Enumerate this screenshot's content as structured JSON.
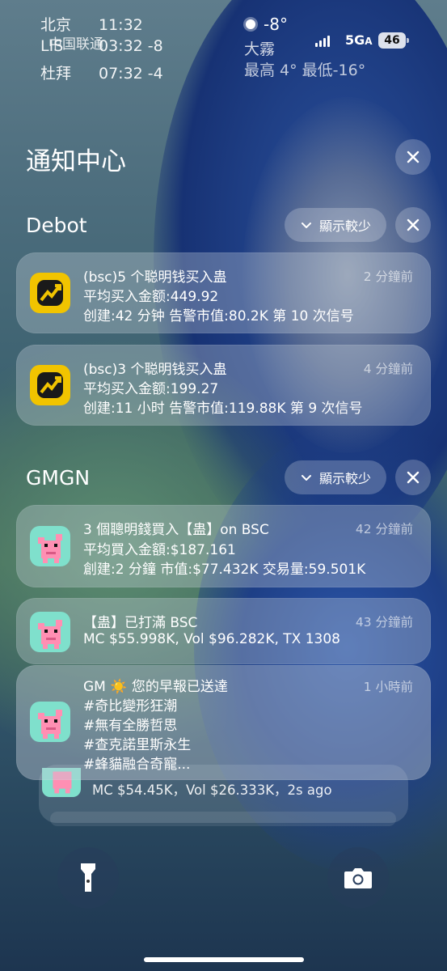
{
  "status": {
    "clocks": [
      {
        "city": "北京",
        "time": "11:32"
      },
      {
        "city": "LIS",
        "time": "03:32 -8"
      },
      {
        "city": "杜拜",
        "time": "07:32 -4"
      }
    ],
    "carrier": "中国联通",
    "weather": {
      "temp": "-8°",
      "desc": "大霧",
      "range": "最高 4° 最低-16°"
    },
    "network": "5G",
    "battery": "46"
  },
  "notification_center": {
    "title": "通知中心"
  },
  "groups": [
    {
      "app": "Debot",
      "show_less": "顯示較少",
      "notifications": [
        {
          "title": "(bsc)5 个聪明钱买入蛊",
          "time": "2 分鐘前",
          "lines": [
            "平均买入金额:449.92",
            "创建:42 分钟 告警市值:80.2K 第 10 次信号"
          ]
        },
        {
          "title": "(bsc)3 个聪明钱买入蛊",
          "time": "4 分鐘前",
          "lines": [
            "平均买入金额:199.27",
            "创建:11 小时 告警市值:119.88K 第 9 次信号"
          ]
        }
      ]
    },
    {
      "app": "GMGN",
      "show_less": "顯示較少",
      "notifications": [
        {
          "title": "3 個聰明錢買入【蛊】on BSC",
          "time": "42 分鐘前",
          "lines": [
            "平均買入金額:$187.161",
            "創建:2 分鐘  市值:$77.432K  交易量:59.501K"
          ]
        },
        {
          "title": "【蛊】已打滿 BSC",
          "time": "43 分鐘前",
          "lines": [
            "MC $55.998K, Vol $96.282K, TX 1308"
          ]
        },
        {
          "title": "GM ☀️ 您的早報已送達",
          "time": "1 小時前",
          "lines": [
            "#奇比變形狂潮",
            "#無有全勝哲思",
            "#查克諾里斯永生",
            "#蜂貓融合奇寵..."
          ]
        }
      ],
      "stacked_preview": "MC $54.45K，Vol $26.333K，2s ago"
    }
  ],
  "icons": {
    "flashlight": "flashlight-icon",
    "camera": "camera-icon",
    "close": "close-icon",
    "chevron": "chevron-down-icon"
  }
}
